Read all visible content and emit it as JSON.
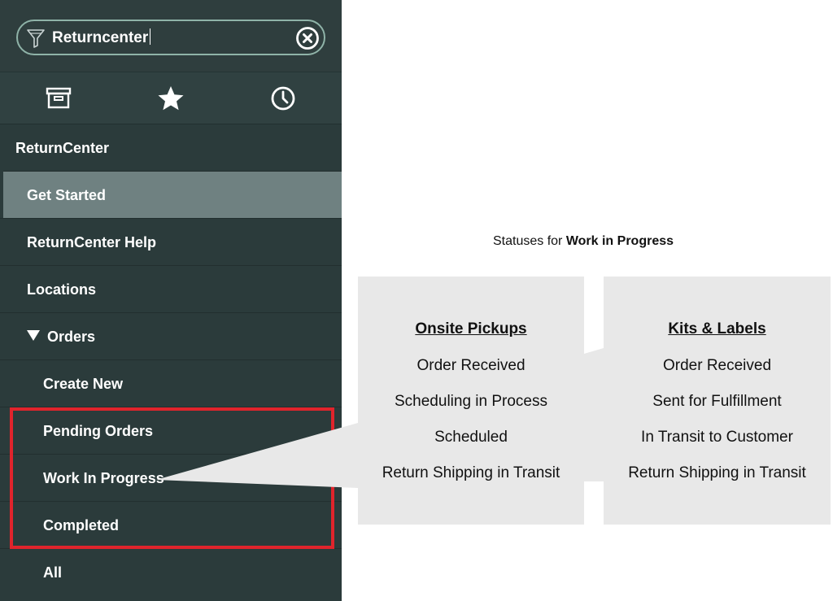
{
  "search": {
    "value": "Returncenter"
  },
  "tabs": [
    {
      "icon": "archive-icon"
    },
    {
      "icon": "star-icon"
    },
    {
      "icon": "clock-icon"
    }
  ],
  "nav": {
    "app_title": "ReturnCenter",
    "get_started": "Get Started",
    "help": "ReturnCenter Help",
    "locations": "Locations",
    "orders": "Orders",
    "create_new": "Create New",
    "pending_orders": "Pending Orders",
    "work_in_progress": "Work In Progress",
    "completed": "Completed",
    "all": "All"
  },
  "caption": {
    "prefix": "Statuses for",
    "bold": "Work in Progress"
  },
  "panels": [
    {
      "title": "Onsite Pickups",
      "items": [
        "Order Received",
        "Scheduling in Process",
        "Scheduled",
        "Return Shipping in Transit"
      ]
    },
    {
      "title": "Kits & Labels",
      "items": [
        "Order Received",
        "Sent for Fulfillment",
        "In Transit to Customer",
        "Return Shipping in Transit"
      ]
    }
  ],
  "colors": {
    "sidebar_bg": "#2b3b3b",
    "selected_bg": "#6f8181",
    "highlight_red": "#e0242c",
    "panel_bg": "#e8e8e8",
    "search_border": "#8fb3a8"
  }
}
